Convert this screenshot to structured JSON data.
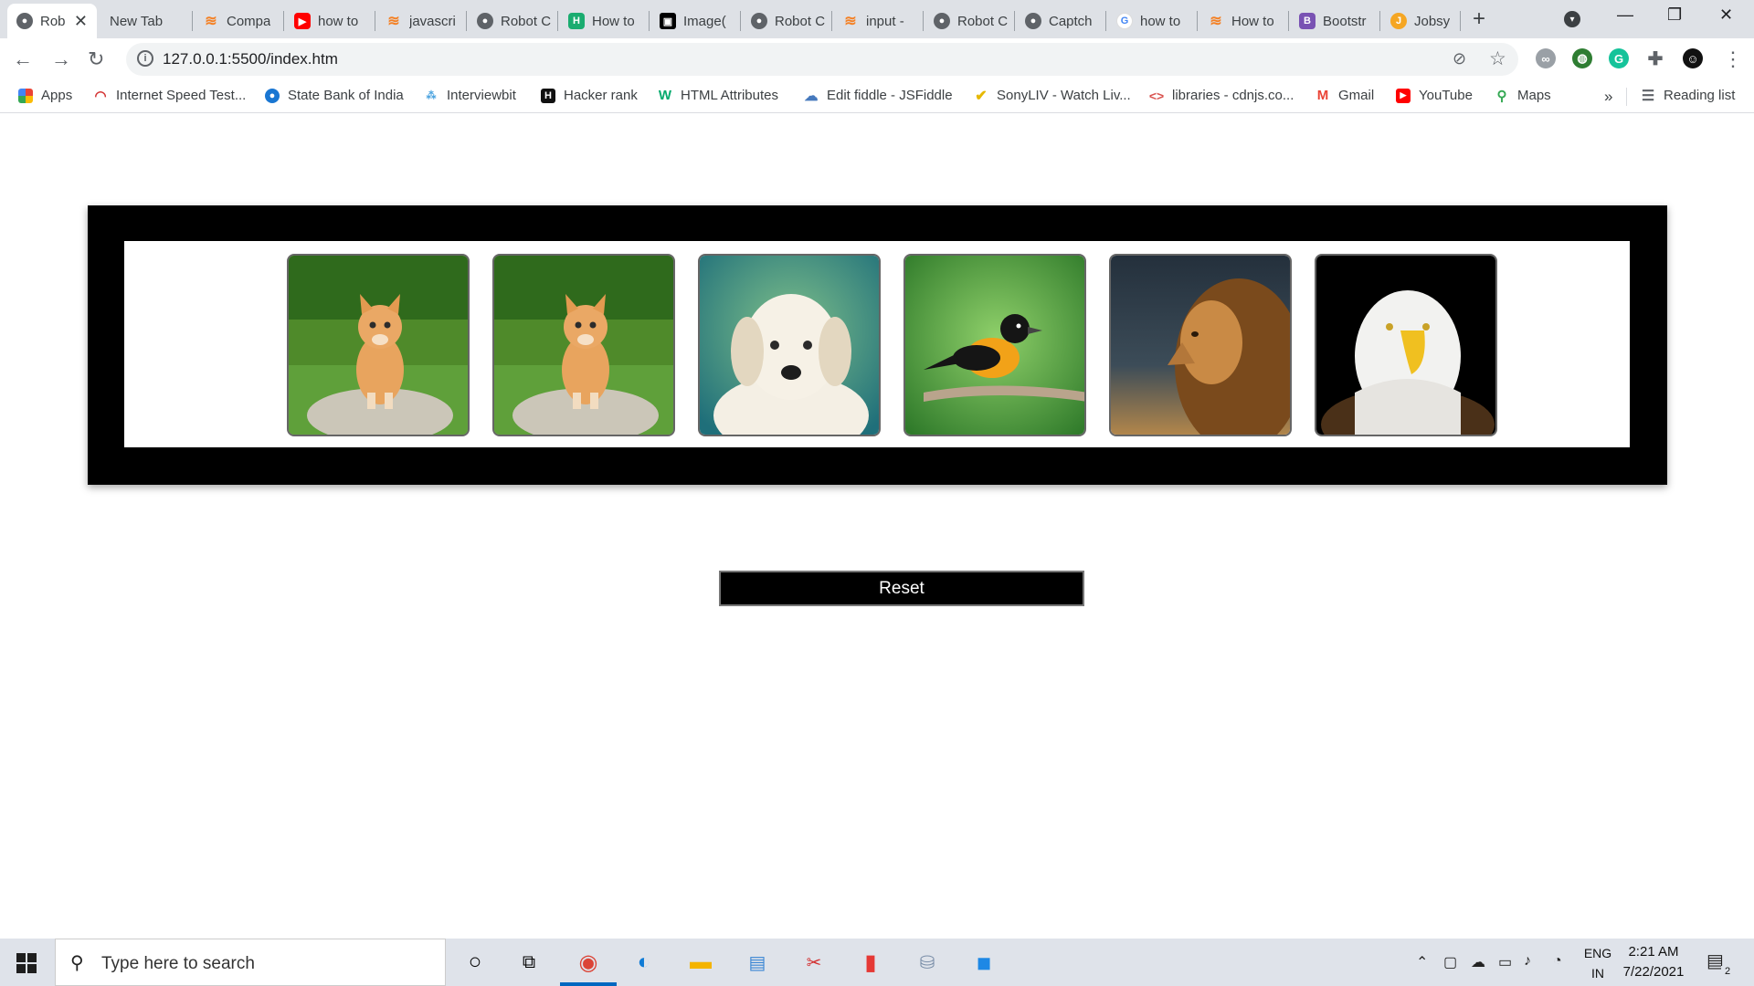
{
  "browser": {
    "tabs": [
      {
        "title": "Rob",
        "icon": "chrome-page-icon",
        "active": true
      },
      {
        "title": "New Tab",
        "icon": "none"
      },
      {
        "title": "Compa",
        "icon": "stackoverflow-icon"
      },
      {
        "title": "how to",
        "icon": "youtube-icon"
      },
      {
        "title": "javascri",
        "icon": "stackoverflow-icon"
      },
      {
        "title": "Robot C",
        "icon": "chrome-page-icon"
      },
      {
        "title": "How to",
        "icon": "hackerrank-icon"
      },
      {
        "title": "Image(",
        "icon": "image-site-icon"
      },
      {
        "title": "Robot C",
        "icon": "chrome-page-icon"
      },
      {
        "title": "input -",
        "icon": "stackoverflow-icon"
      },
      {
        "title": "Robot C",
        "icon": "chrome-page-icon"
      },
      {
        "title": "Captch",
        "icon": "chrome-page-icon"
      },
      {
        "title": "how to",
        "icon": "google-icon"
      },
      {
        "title": "How to",
        "icon": "stackoverflow-icon"
      },
      {
        "title": "Bootstr",
        "icon": "bootstrap-icon"
      },
      {
        "title": "Jobsy",
        "icon": "jobsy-icon"
      }
    ],
    "url": "127.0.0.1:5500/index.htm",
    "bookmarks": [
      {
        "label": "Apps",
        "icon": "apps-grid-icon"
      },
      {
        "label": "Internet Speed Test...",
        "icon": "speedtest-icon"
      },
      {
        "label": "State Bank of India",
        "icon": "sbi-icon"
      },
      {
        "label": "Interviewbit",
        "icon": "interviewbit-icon"
      },
      {
        "label": "Hacker rank",
        "icon": "hackerrank-icon"
      },
      {
        "label": "HTML Attributes",
        "icon": "w3schools-icon"
      },
      {
        "label": "Edit fiddle - JSFiddle",
        "icon": "jsfiddle-icon"
      },
      {
        "label": "SonyLIV - Watch Liv...",
        "icon": "sonyliv-icon"
      },
      {
        "label": "libraries - cdnjs.co...",
        "icon": "cdnjs-icon"
      },
      {
        "label": "Gmail",
        "icon": "gmail-icon"
      },
      {
        "label": "YouTube",
        "icon": "youtube-icon"
      },
      {
        "label": "Maps",
        "icon": "maps-icon"
      }
    ],
    "overflow_label": "»",
    "reading_list_label": "Reading list"
  },
  "page": {
    "images": [
      {
        "subject": "kitten"
      },
      {
        "subject": "kitten"
      },
      {
        "subject": "puppy"
      },
      {
        "subject": "oriole bird"
      },
      {
        "subject": "lion"
      },
      {
        "subject": "bald eagle"
      }
    ],
    "reset_label": "Reset"
  },
  "taskbar": {
    "search_placeholder": "Type here to search",
    "lang_top": "ENG",
    "lang_bottom": "IN",
    "time": "2:21 AM",
    "date": "7/22/2021",
    "notification_count": "2"
  }
}
